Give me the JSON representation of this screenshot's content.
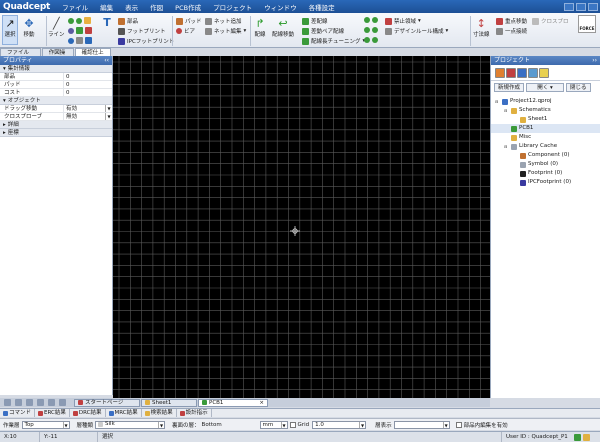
{
  "app": {
    "logo": "Quadcept",
    "menu": [
      "ファイル",
      "編集",
      "表示",
      "作図",
      "PCB作成",
      "プロジェクト",
      "ウィンドウ",
      "各種設定"
    ]
  },
  "ribbon": {
    "select": "選択",
    "move": "移動",
    "line": "ライン",
    "part": "部品",
    "footprint": "フットプリント",
    "ipc_footprint": "IPCフットプリント",
    "pad": "パッド",
    "via": "ビア",
    "net_add": "ネット追加",
    "net_edit": "ネット編集",
    "route": "配線",
    "route_move": "配線移動",
    "auto_route": "差配線",
    "diff_pair": "差動ペア配線",
    "length_tune": "配線長チューニング",
    "keepout": "禁止領域",
    "design_rule": "デザインルール構成",
    "dim": "寸法線",
    "point_move": "重点移動",
    "one_point": "一点接続",
    "cross_probe": "クロスプロ",
    "force": "FORCE"
  },
  "left_tabs": [
    "ファイル操作",
    "作図操作",
    "確認仕上げ"
  ],
  "properties": {
    "title": "プロパティ",
    "summary": {
      "label": "集計情報",
      "rows": [
        {
          "key": "部品",
          "value": "0"
        },
        {
          "key": "パッド",
          "value": "0"
        },
        {
          "key": "コスト",
          "value": "0"
        }
      ]
    },
    "object": {
      "label": "オブジェクト",
      "rows": [
        {
          "key": "ドラッグ移動",
          "value": "有効"
        },
        {
          "key": "クロスプローブ",
          "value": "無効"
        }
      ]
    },
    "details": "詳細",
    "coords": "座標"
  },
  "project": {
    "title": "プロジェクト",
    "buttons": {
      "create": "新規作成",
      "open": "開く",
      "close": "閉じる"
    },
    "tree": [
      {
        "label": "Project12.qproj",
        "level": 0,
        "color": "#3b6fc4"
      },
      {
        "label": "Schematics",
        "level": 1,
        "color": "#e0b040"
      },
      {
        "label": "Sheet1",
        "level": 2,
        "color": "#e0b040"
      },
      {
        "label": "PCB1",
        "level": 1,
        "color": "#3a9a3a"
      },
      {
        "label": "Misc",
        "level": 1,
        "color": "#e0b040"
      },
      {
        "label": "Library Cache",
        "level": 1,
        "color": "#9aa3b0"
      },
      {
        "label": "Component (0)",
        "level": 2,
        "color": "#c07030"
      },
      {
        "label": "Symbol (0)",
        "level": 2,
        "color": "#9aa3b0"
      },
      {
        "label": "Footprint (0)",
        "level": 2,
        "color": "#222222"
      },
      {
        "label": "IPCFootprint (0)",
        "level": 2,
        "color": "#3a3aa0"
      }
    ]
  },
  "doc_tabs": [
    "スタートページ",
    "Sheet1",
    "PCB1"
  ],
  "output_tabs": [
    "コマンド",
    "ERC結果",
    "DRC結果",
    "MRC結果",
    "検索結果",
    "設計指示"
  ],
  "settings": {
    "layer_label": "作業層",
    "layer_value": "Top",
    "type_label": "層種類",
    "type_value": "Silk",
    "back_label": "裏面の層：",
    "back_value": "Bottom",
    "unit_value": "mm",
    "grid_label": "Grid",
    "grid_value": "1.0",
    "view_label": "層表示",
    "inner_edit": "部品内編集を有効"
  },
  "status": {
    "x": "X:10",
    "y": "Y:-11",
    "mode": "選択",
    "user": "User ID : Quadcept_P1"
  }
}
